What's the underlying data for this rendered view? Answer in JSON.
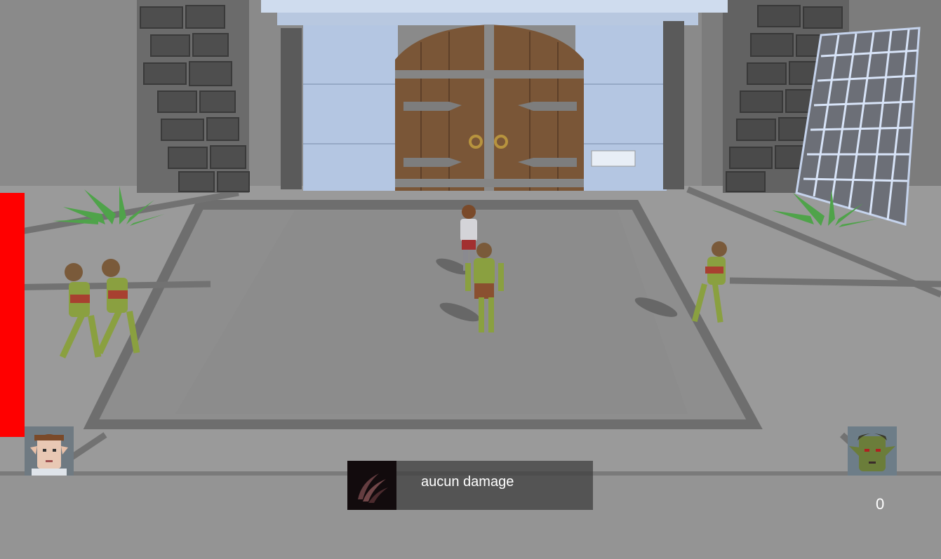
{
  "hud": {
    "health": {
      "fraction": 1.0,
      "color": "#ff0000"
    },
    "damage_message": "aucun damage",
    "score": "0",
    "icons": {
      "player_portrait": "elf-girl-portrait-icon",
      "enemy_portrait": "goblin-portrait-icon",
      "damage_icon": "claw-slash-icon"
    }
  },
  "scene": {
    "palette": {
      "floor": "#8e8e8e",
      "wall": "#858585",
      "door_wood": "#7a5637",
      "door_frame": "#b8c8e0",
      "stone": "#555555",
      "goblin_skin": "#8aa040",
      "plants": "#4fa34a"
    }
  }
}
